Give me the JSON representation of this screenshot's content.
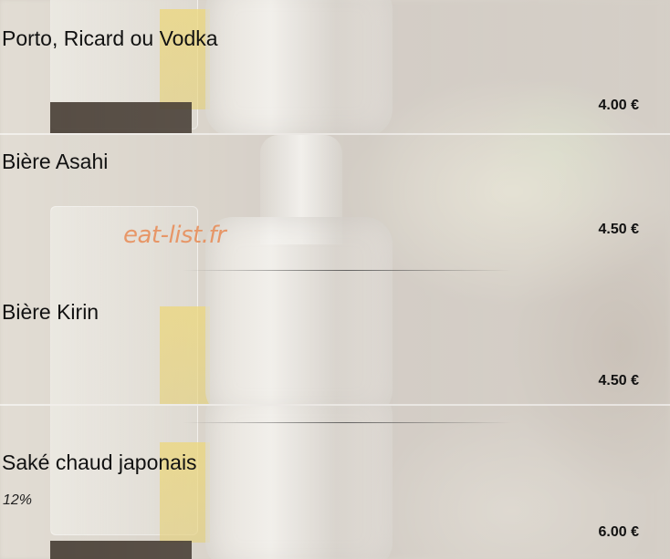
{
  "menu": {
    "items": [
      {
        "name": "Porto, Ricard ou Vodka",
        "price": "4.00 €"
      },
      {
        "name": "Bière Asahi",
        "price": "4.50 €"
      },
      {
        "name": "Bière Kirin",
        "price": "4.50 €"
      },
      {
        "name": "Saké chaud japonais",
        "subtitle": "12%",
        "price": "6.00 €"
      }
    ]
  },
  "watermark": "eat-list.fr",
  "colors": {
    "watermark": "#e88a54",
    "text": "#111111",
    "background": "#d7d1c9"
  }
}
